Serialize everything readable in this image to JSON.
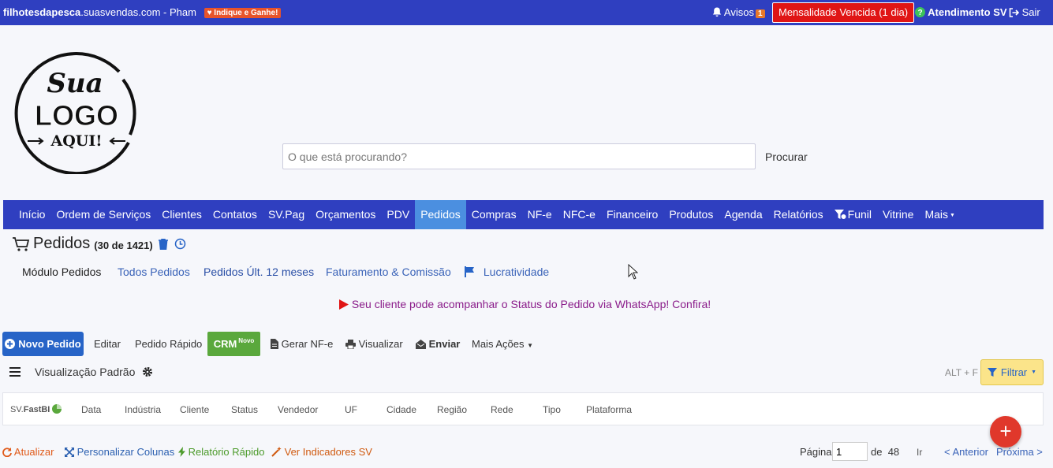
{
  "topbar": {
    "domain_bold": "filhotesdapesca",
    "domain_rest": ".suasvendas.com - Pham",
    "indique": "Indique e Ganhe!",
    "avisos": "Avisos",
    "avisos_count": "1",
    "mensalidade": "Mensalidade Vencida (1 dia)",
    "atendimento": "Atendimento SV",
    "sair": "Sair"
  },
  "logo": {
    "line1": "Sua",
    "line2": "LOGO",
    "line3": "AQUI!"
  },
  "search": {
    "placeholder": "O que está procurando?",
    "button": "Procurar"
  },
  "nav": {
    "items": [
      "Início",
      "Ordem de Serviços",
      "Clientes",
      "Contatos",
      "SV.Pag",
      "Orçamentos",
      "PDV",
      "Pedidos",
      "Compras",
      "NF-e",
      "NFC-e",
      "Financeiro",
      "Produtos",
      "Agenda",
      "Relatórios",
      "Funil",
      "Vitrine",
      "Mais"
    ],
    "active": "Pedidos"
  },
  "page": {
    "title": "Pedidos",
    "count": "(30 de 1421)"
  },
  "submenu": {
    "modulo": "Módulo Pedidos",
    "todos": "Todos Pedidos",
    "ult12": "Pedidos Últ. 12 meses",
    "faturamento": "Faturamento & Comissão",
    "lucratividade": "Lucratividade"
  },
  "promo": "Seu cliente pode acompanhar o Status do Pedido via WhatsApp! Confira!",
  "toolbar": {
    "novo": "Novo Pedido",
    "editar": "Editar",
    "rapido": "Pedido Rápido",
    "crm": "CRM",
    "crm_badge": "Novo",
    "nfe": "Gerar NF-e",
    "visualizar": "Visualizar",
    "enviar": "Enviar",
    "mais": "Mais Ações"
  },
  "view": {
    "label": "Visualização Padrão",
    "shortcut": "ALT + F",
    "filtrar": "Filtrar"
  },
  "table": {
    "fastbi_prefix": "SV.",
    "fastbi": "FastBI",
    "columns": [
      "Data",
      "Indústria",
      "Cliente",
      "Status",
      "Vendedor",
      "UF",
      "Cidade",
      "Região",
      "Rede",
      "Tipo",
      "Plataforma"
    ]
  },
  "footer": {
    "atualizar": "Atualizar",
    "personalizar": "Personalizar Colunas",
    "relatorio": "Relatório Rápido",
    "indicadores": "Ver Indicadores SV",
    "pagina": "Página",
    "page_value": "1",
    "de": "de",
    "total_pages": "48",
    "ir": "Ir",
    "anterior": "< Anterior",
    "proxima": "Próxima >"
  },
  "colors": {
    "brand": "#2f3fc0",
    "active_tab": "#4b8fe0",
    "primary": "#2764c7",
    "crm": "#5aa83c",
    "danger": "#e01515",
    "fab": "#e0382b"
  }
}
